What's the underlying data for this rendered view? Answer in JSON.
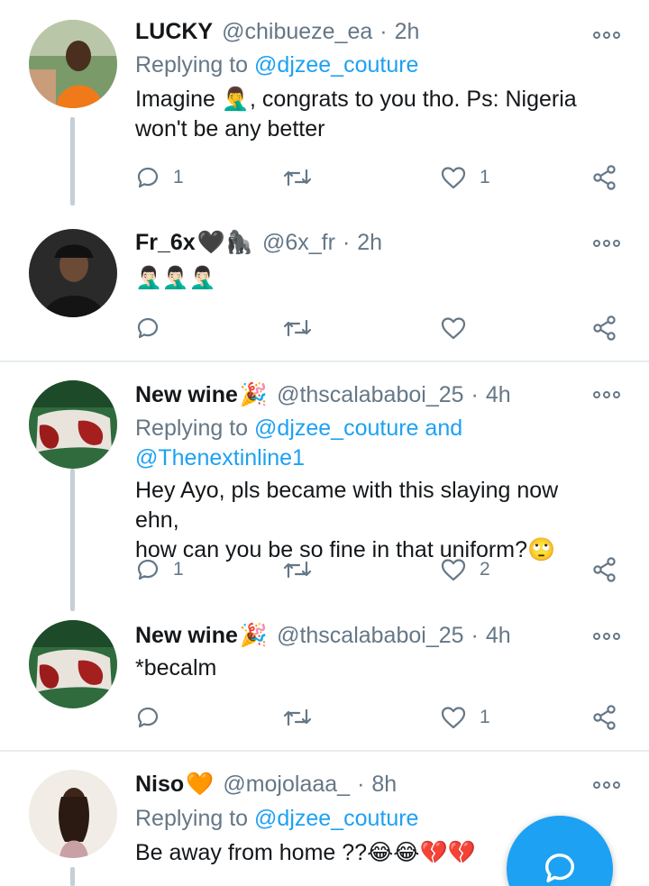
{
  "tweets": [
    {
      "name": "LUCKY",
      "handle": "@chibueze_ea",
      "time": "2h",
      "reply_prefix": "Replying to ",
      "reply_mentions": "@djzee_couture",
      "reply_line2": "",
      "body_line1": "Imagine 🤦‍♂️, congrats to you tho. Ps: Nigeria",
      "body_line2": "won't be any better",
      "replies": "1",
      "retweets": "",
      "likes": "1"
    },
    {
      "name": "Fr_6x",
      "name_emoji": "🖤🦍",
      "handle": "@6x_fr",
      "time": "2h",
      "body_line1": "🤦🏻‍♂️🤦🏻‍♂️🤦🏻‍♂️",
      "replies": "",
      "retweets": "",
      "likes": ""
    },
    {
      "name": "New wine",
      "name_emoji": "🎉",
      "handle": "@thscalababoi_25",
      "time": "4h",
      "reply_prefix": "Replying to ",
      "reply_mentions": "@djzee_couture and",
      "reply_line2": "@Thenextinline1",
      "body_line1": "Hey Ayo, pls became with this slaying now ehn,",
      "body_line2": "how can you be so fine in that uniform?🙄",
      "replies": "1",
      "retweets": "",
      "likes": "2"
    },
    {
      "name": "New wine",
      "name_emoji": "🎉",
      "handle": "@thscalababoi_25",
      "time": "4h",
      "body_line1": "*becalm",
      "replies": "",
      "retweets": "",
      "likes": "1"
    },
    {
      "name": "Niso",
      "name_emoji": "🧡",
      "handle": "@mojolaaa_",
      "time": "8h",
      "reply_prefix": "Replying to ",
      "reply_mentions": "@djzee_couture",
      "body_line1": "Be away from home ??😂😂💔💔"
    }
  ],
  "separator": "·",
  "colors": {
    "accent": "#1da1f2",
    "muted": "#657786",
    "text": "#14171a",
    "thread_line": "#c4cfd6",
    "divider": "#e6ecf0"
  },
  "icons": [
    "reply-icon",
    "retweet-icon",
    "like-icon",
    "share-icon",
    "more-icon",
    "compose-reply-icon"
  ]
}
